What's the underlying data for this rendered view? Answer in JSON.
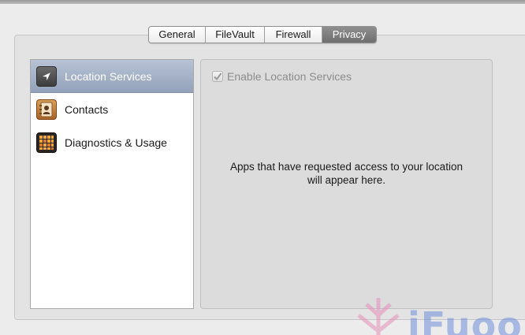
{
  "tabs": [
    {
      "label": "General",
      "active": false
    },
    {
      "label": "FileVault",
      "active": false
    },
    {
      "label": "Firewall",
      "active": false
    },
    {
      "label": "Privacy",
      "active": true
    }
  ],
  "sidebar": {
    "items": [
      {
        "label": "Location Services",
        "icon": "location-arrow-icon",
        "selected": true
      },
      {
        "label": "Contacts",
        "icon": "address-book-icon",
        "selected": false
      },
      {
        "label": "Diagnostics & Usage",
        "icon": "diagnostics-grid-icon",
        "selected": false
      }
    ]
  },
  "detail": {
    "enable_checkbox": {
      "label": "Enable Location Services",
      "checked": true,
      "enabled": false
    },
    "message": "Apps that have requested access to your location will appear here."
  },
  "watermark": {
    "text": "iFuoon"
  },
  "colors": {
    "window_bg": "#ececec",
    "selection": "#9aa9c1",
    "active_tab": "#7f7f7f",
    "watermark": "#6f8fdc",
    "watermark_mark": "#e58fb8"
  }
}
